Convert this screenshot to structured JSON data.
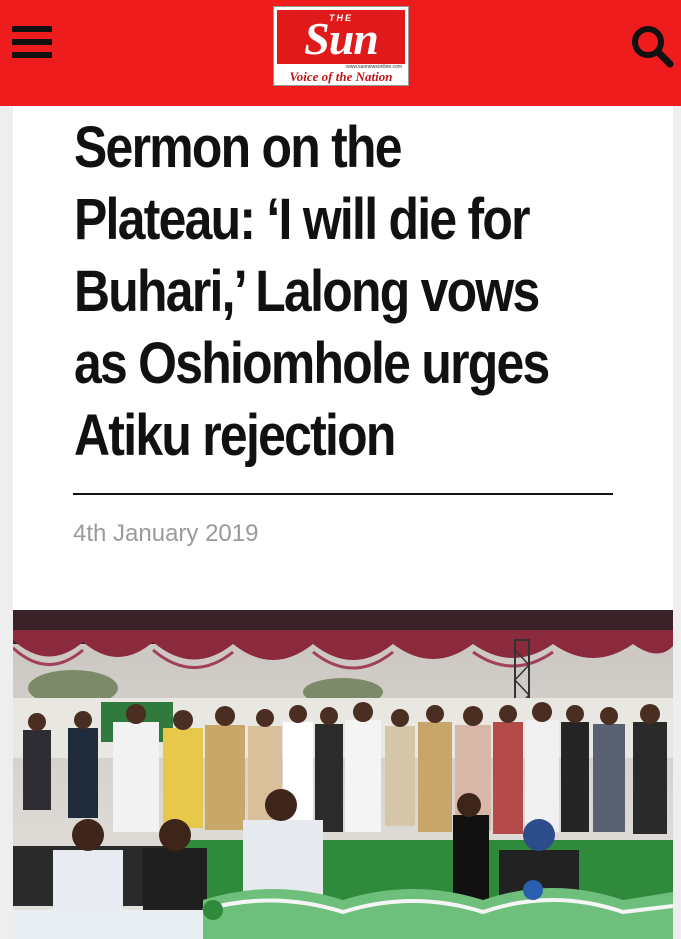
{
  "header": {
    "menu_icon": "hamburger-menu-icon",
    "search_icon": "search-icon",
    "logo": {
      "the": "THE",
      "name": "Sun",
      "url": "www.sunnewsonline.com",
      "tagline": "Voice of the Nation"
    },
    "colors": {
      "bar": "#ee1c1c",
      "logo_red": "#e0191b"
    }
  },
  "article": {
    "title": "Sermon on the Plateau: ‘I will die for Buhari,’ Lalong vows as Oshiomhole urges Atiku rejection",
    "date": "4th January 2019",
    "image": "rally-stage-photo"
  }
}
